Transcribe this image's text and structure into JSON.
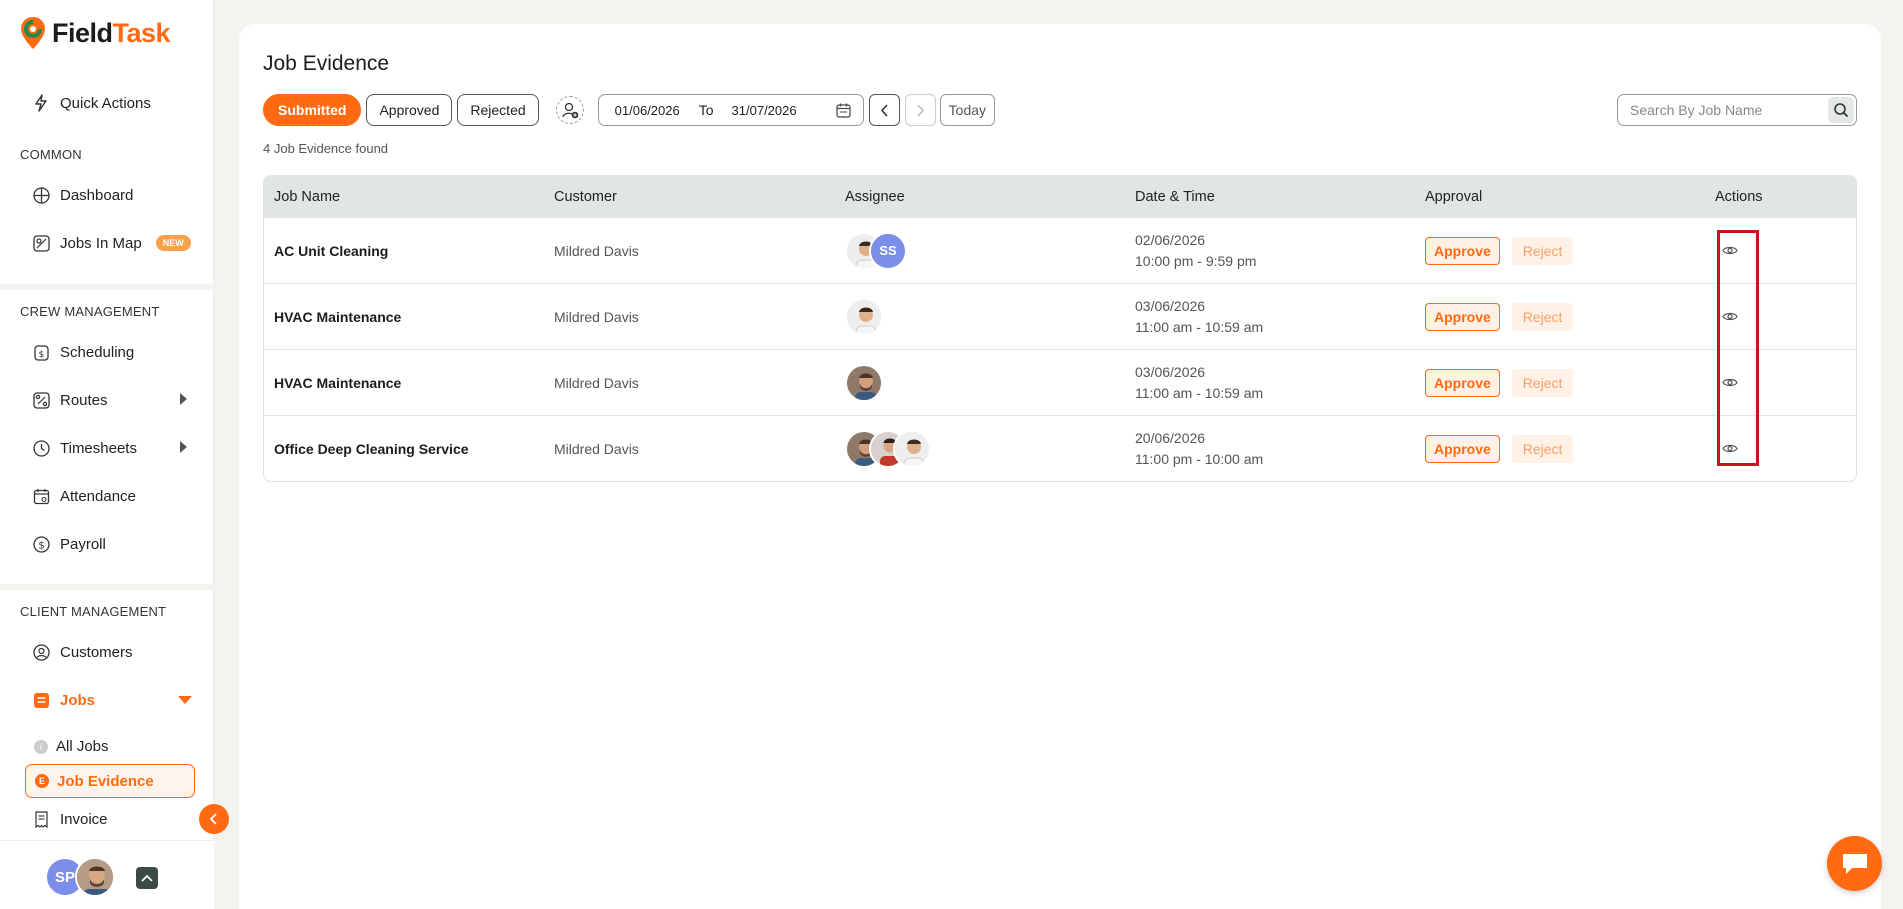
{
  "app": {
    "name_part1": "Field",
    "name_part2": "Task"
  },
  "sidebar": {
    "quick_actions": "Quick Actions",
    "sections": {
      "common": "COMMON",
      "crew": "CREW MANAGEMENT",
      "client": "CLIENT MANAGEMENT"
    },
    "items": {
      "dashboard": "Dashboard",
      "jobs_in_map": "Jobs In Map",
      "jobs_in_map_badge": "NEW",
      "scheduling": "Scheduling",
      "routes": "Routes",
      "timesheets": "Timesheets",
      "attendance": "Attendance",
      "payroll": "Payroll",
      "customers": "Customers",
      "jobs": "Jobs",
      "all_jobs": "All Jobs",
      "all_jobs_dot": "i",
      "job_evidence": "Job Evidence",
      "job_evidence_dot": "E",
      "invoice": "Invoice"
    },
    "user": {
      "initials": "SP"
    }
  },
  "main": {
    "title": "Job Evidence",
    "tabs": {
      "submitted": "Submitted",
      "approved": "Approved",
      "rejected": "Rejected"
    },
    "date_from": "01/06/2026",
    "date_to_label": "To",
    "date_to": "31/07/2026",
    "today": "Today",
    "search_placeholder": "Search By Job Name",
    "found_text": "4 Job Evidence found",
    "columns": {
      "job_name": "Job Name",
      "customer": "Customer",
      "assignee": "Assignee",
      "date_time": "Date & Time",
      "approval": "Approval",
      "actions": "Actions"
    },
    "approve_label": "Approve",
    "reject_label": "Reject",
    "rows": [
      {
        "job": "AC Unit Cleaning",
        "customer": "Mildred Davis",
        "date": "02/06/2026",
        "time": "10:00 pm - 9:59 pm",
        "assignee_initials": "SS"
      },
      {
        "job": "HVAC Maintenance",
        "customer": "Mildred Davis",
        "date": "03/06/2026",
        "time": "11:00 am - 10:59 am"
      },
      {
        "job": "HVAC Maintenance",
        "customer": "Mildred Davis",
        "date": "03/06/2026",
        "time": "11:00 am - 10:59 am"
      },
      {
        "job": "Office Deep Cleaning Service",
        "customer": "Mildred Davis",
        "date": "20/06/2026",
        "time": "11:00 pm - 10:00 am"
      }
    ]
  },
  "colors": {
    "accent": "#ff6a13",
    "highlight": "#c8141e",
    "header_bg": "#dfe6e3"
  }
}
